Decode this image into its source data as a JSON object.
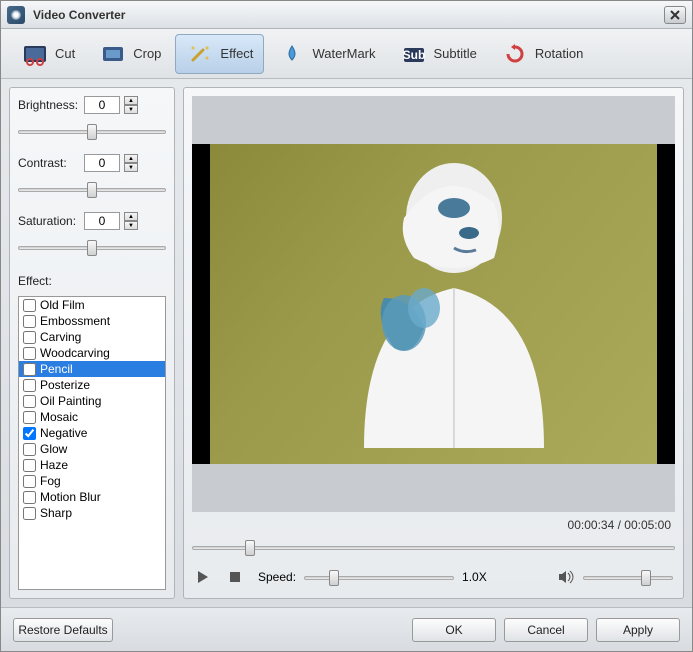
{
  "title": "Video Converter",
  "tabs": {
    "cut": "Cut",
    "crop": "Crop",
    "effect": "Effect",
    "watermark": "WaterMark",
    "subtitle": "Subtitle",
    "rotation": "Rotation",
    "active": "effect"
  },
  "params": {
    "brightness": {
      "label": "Brightness:",
      "value": "0",
      "slider_pct": 50
    },
    "contrast": {
      "label": "Contrast:",
      "value": "0",
      "slider_pct": 50
    },
    "saturation": {
      "label": "Saturation:",
      "value": "0",
      "slider_pct": 50
    }
  },
  "effect_label": "Effect:",
  "effects": [
    {
      "name": "Old Film",
      "checked": false,
      "selected": false
    },
    {
      "name": "Embossment",
      "checked": false,
      "selected": false
    },
    {
      "name": "Carving",
      "checked": false,
      "selected": false
    },
    {
      "name": "Woodcarving",
      "checked": false,
      "selected": false
    },
    {
      "name": "Pencil",
      "checked": false,
      "selected": true
    },
    {
      "name": "Posterize",
      "checked": false,
      "selected": false
    },
    {
      "name": "Oil Painting",
      "checked": false,
      "selected": false
    },
    {
      "name": "Mosaic",
      "checked": false,
      "selected": false
    },
    {
      "name": "Negative",
      "checked": true,
      "selected": false
    },
    {
      "name": "Glow",
      "checked": false,
      "selected": false
    },
    {
      "name": "Haze",
      "checked": false,
      "selected": false
    },
    {
      "name": "Fog",
      "checked": false,
      "selected": false
    },
    {
      "name": "Motion Blur",
      "checked": false,
      "selected": false
    },
    {
      "name": "Sharp",
      "checked": false,
      "selected": false
    }
  ],
  "playback": {
    "current": "00:00:34",
    "duration": "00:05:00",
    "time_sep": " / ",
    "seek_pct": 12,
    "speed_label": "Speed:",
    "speed_text": "1.0X",
    "speed_pct": 20,
    "volume_pct": 70
  },
  "buttons": {
    "restore": "Restore Defaults",
    "ok": "OK",
    "cancel": "Cancel",
    "apply": "Apply"
  },
  "colors": {
    "selection": "#2a7de1"
  }
}
